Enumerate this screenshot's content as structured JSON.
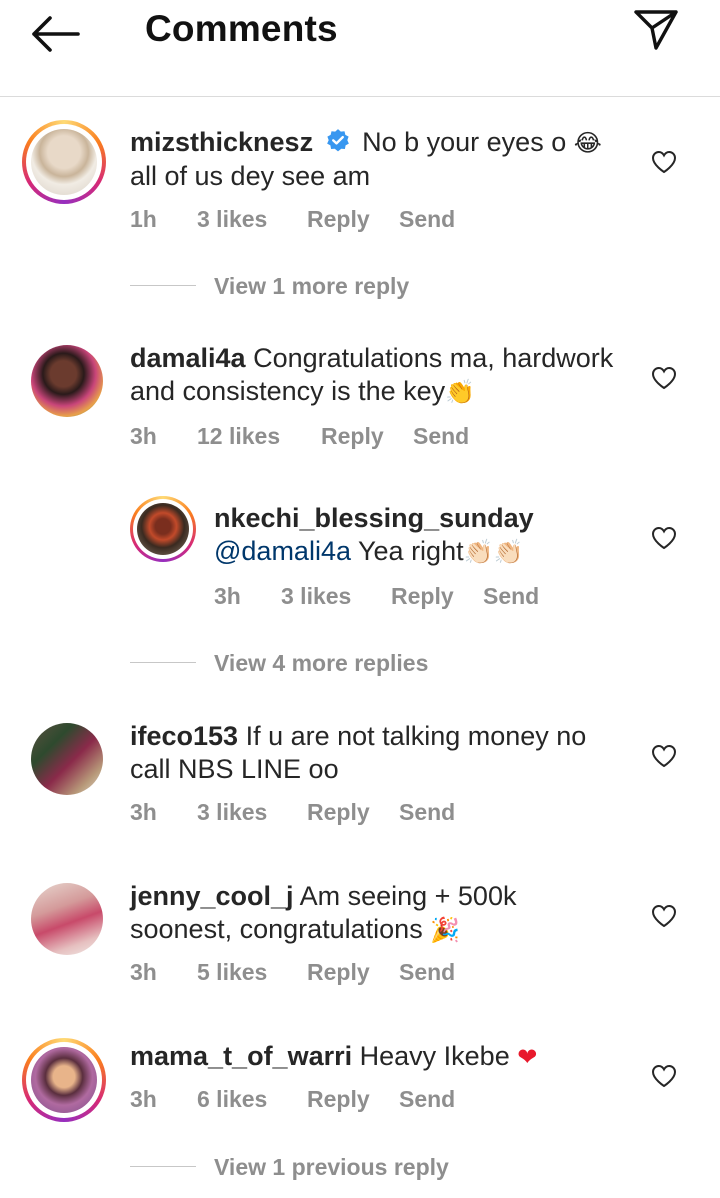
{
  "header": {
    "title": "Comments"
  },
  "comments": [
    {
      "user": "mizsthicknesz",
      "verified": true,
      "text_lines": [
        "No b your eyes o",
        "all of us dey see am"
      ],
      "emoji": "😂",
      "time": "1h",
      "likes": "3 likes",
      "reply": "Reply",
      "send": "Send",
      "view_more": "View 1 more reply"
    },
    {
      "user": "damali4a",
      "text_lines": [
        "Congratulations ma, hardwork",
        "and consistency is the key"
      ],
      "emoji": "👏",
      "time": "3h",
      "likes": "12 likes",
      "reply": "Reply",
      "send": "Send"
    },
    {
      "user": "nkechi_blessing_sunday",
      "mention": "@damali4a",
      "text": "Yea right",
      "emoji": "👏🏻👏🏻",
      "time": "3h",
      "likes": "3 likes",
      "reply": "Reply",
      "send": "Send",
      "view_more": "View 4 more replies"
    },
    {
      "user": "ifeco153",
      "text_lines": [
        "If u are not talking money no",
        "call NBS LINE oo"
      ],
      "time": "3h",
      "likes": "3 likes",
      "reply": "Reply",
      "send": "Send"
    },
    {
      "user": "jenny_cool_j",
      "text_lines": [
        "Am seeing + 500k",
        "soonest, congratulations"
      ],
      "emoji": "🎉",
      "time": "3h",
      "likes": "5 likes",
      "reply": "Reply",
      "send": "Send"
    },
    {
      "user": "mama_t_of_warri",
      "text": "Heavy Ikebe",
      "emoji": "❤",
      "time": "3h",
      "likes": "6 likes",
      "reply": "Reply",
      "send": "Send",
      "view_more": "View 1 previous reply"
    }
  ],
  "colors": {
    "text": "#262626",
    "meta": "#8e8e8e",
    "mention": "#00376b",
    "verified": "#3897f0",
    "heart_red": "#ed4956"
  }
}
